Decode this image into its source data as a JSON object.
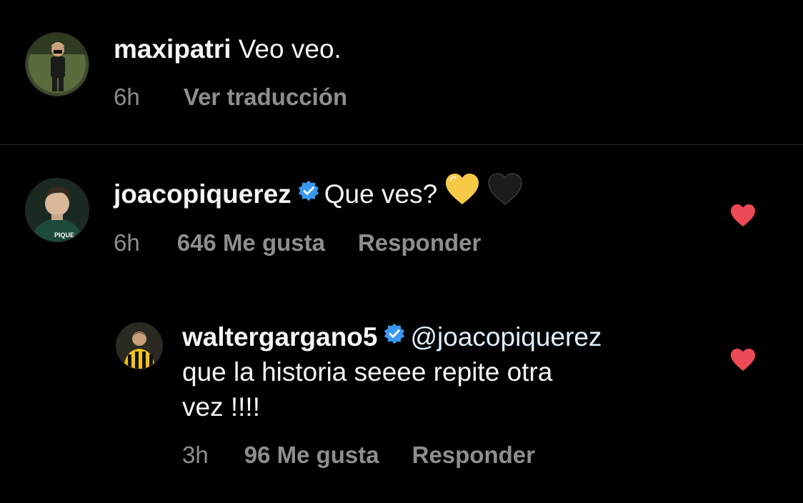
{
  "comments": [
    {
      "username": "maxipatri",
      "text": "Veo veo.",
      "time": "6h",
      "translate_label": "Ver traducción",
      "verified": false
    },
    {
      "username": "joacopiquerez",
      "text": "Que ves?",
      "emojis": [
        "yellow-heart-icon",
        "black-heart-icon"
      ],
      "time": "6h",
      "likes": "646 Me gusta",
      "reply_label": "Responder",
      "verified": true,
      "liked": true,
      "avatar_jersey_text": "PIQUE"
    },
    {
      "username": "waltergargano5",
      "mention": "@joacopiquerez",
      "text_line2": "que la historia seeee repite otra",
      "text_line3": "vez !!!!",
      "time": "3h",
      "likes": "96 Me gusta",
      "reply_label": "Responder",
      "verified": true,
      "liked": true
    }
  ],
  "colors": {
    "background": "#000000",
    "text": "#f5f5f5",
    "muted": "#8e8e8e",
    "verified": "#3897f0",
    "like": "#ed4956",
    "mention": "#e0f1ff"
  }
}
